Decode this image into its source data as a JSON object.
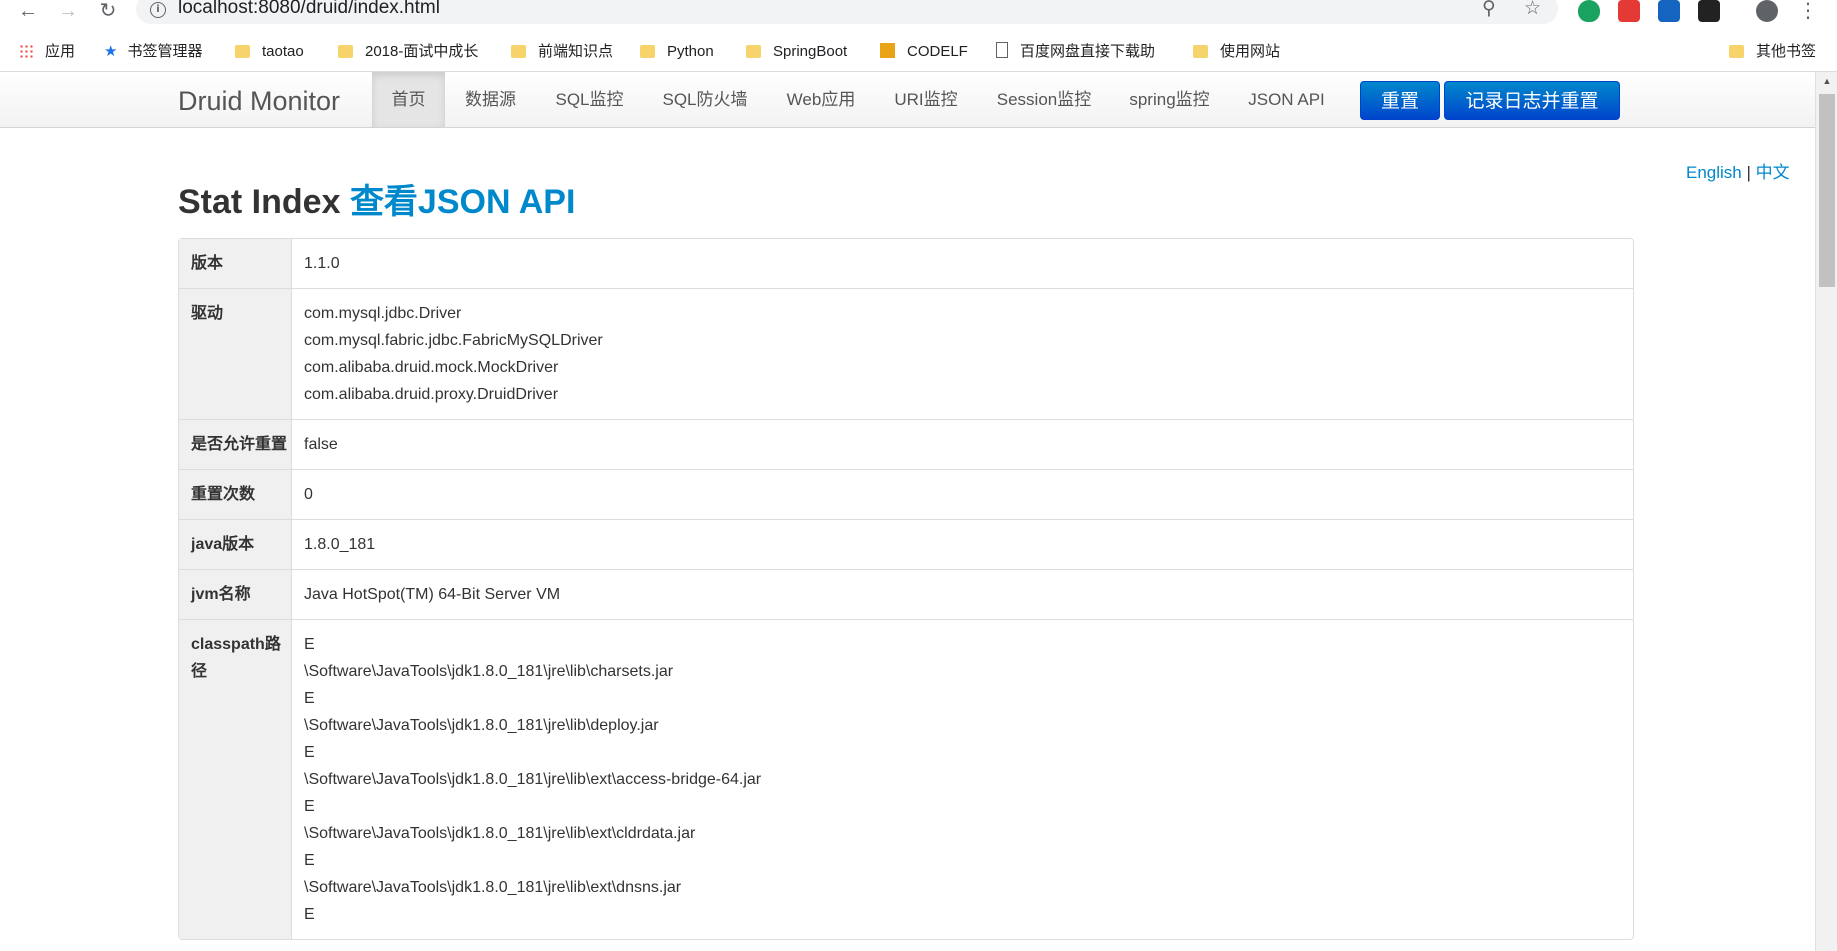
{
  "browser": {
    "url": "localhost:8080/druid/index.html",
    "bookmarks": [
      {
        "label": "应用",
        "icon": "apps-grid-icon"
      },
      {
        "label": "书签管理器",
        "icon": "star-icon"
      },
      {
        "label": "taotao",
        "icon": "folder-icon"
      },
      {
        "label": "2018-面试中成长",
        "icon": "folder-icon"
      },
      {
        "label": "前端知识点",
        "icon": "folder-icon"
      },
      {
        "label": "Python",
        "icon": "folder-icon"
      },
      {
        "label": "SpringBoot",
        "icon": "folder-icon"
      },
      {
        "label": "CODELF",
        "icon": "codelf-icon"
      },
      {
        "label": "百度网盘直接下载助",
        "icon": "page-icon"
      },
      {
        "label": "使用网站",
        "icon": "folder-icon"
      }
    ],
    "other_bookmarks": "其他书签"
  },
  "navbar": {
    "brand": "Druid Monitor",
    "items": [
      "首页",
      "数据源",
      "SQL监控",
      "SQL防火墙",
      "Web应用",
      "URI监控",
      "Session监控",
      "spring监控",
      "JSON API"
    ],
    "reset_button": "重置",
    "log_reset_button": "记录日志并重置"
  },
  "lang": {
    "english": "English",
    "sep": "|",
    "chinese": "中文"
  },
  "heading": {
    "title": "Stat Index",
    "link": "查看JSON API"
  },
  "stats": {
    "version": {
      "label": "版本",
      "value": "1.1.0"
    },
    "drivers": {
      "label": "驱动",
      "values": [
        "com.mysql.jdbc.Driver",
        "com.mysql.fabric.jdbc.FabricMySQLDriver",
        "com.alibaba.druid.mock.MockDriver",
        "com.alibaba.druid.proxy.DruidDriver"
      ]
    },
    "reset_enable": {
      "label": "是否允许重置",
      "value": "false"
    },
    "reset_count": {
      "label": "重置次数",
      "value": "0"
    },
    "java_version": {
      "label": "java版本",
      "value": "1.8.0_181"
    },
    "jvm_name": {
      "label": "jvm名称",
      "value": "Java HotSpot(TM) 64-Bit Server VM"
    },
    "classpath": {
      "label": "classpath路径",
      "values": [
        "E",
        "\\Software\\JavaTools\\jdk1.8.0_181\\jre\\lib\\charsets.jar",
        "E",
        "\\Software\\JavaTools\\jdk1.8.0_181\\jre\\lib\\deploy.jar",
        "E",
        "\\Software\\JavaTools\\jdk1.8.0_181\\jre\\lib\\ext\\access-bridge-64.jar",
        "E",
        "\\Software\\JavaTools\\jdk1.8.0_181\\jre\\lib\\ext\\cldrdata.jar",
        "E",
        "\\Software\\JavaTools\\jdk1.8.0_181\\jre\\lib\\ext\\dnsns.jar",
        "E"
      ]
    }
  }
}
